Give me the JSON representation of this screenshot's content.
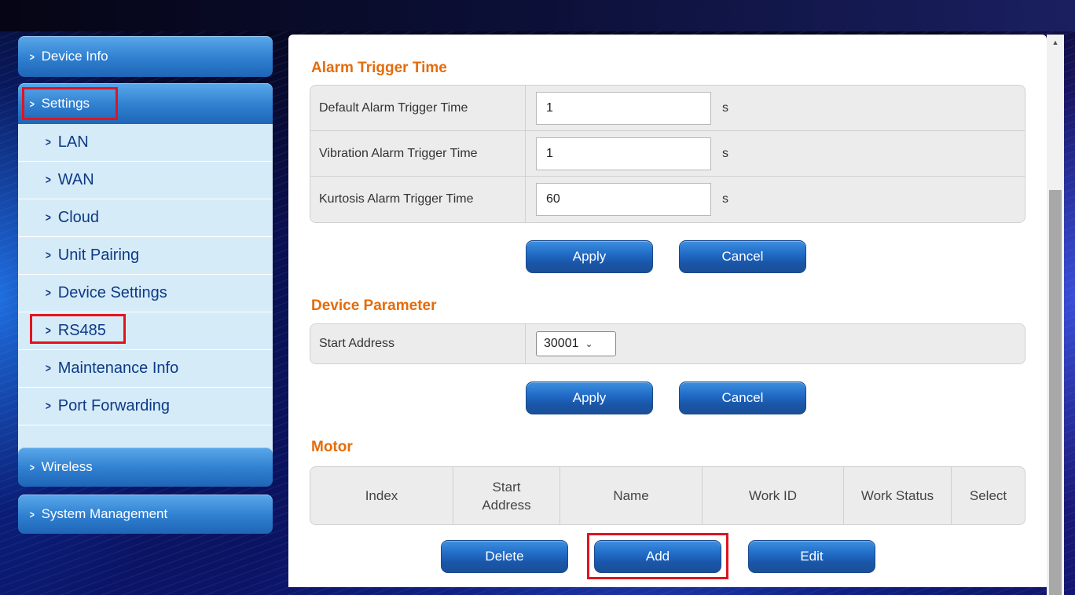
{
  "sidebar": {
    "device_info": "Device Info",
    "settings": "Settings",
    "settings_items": [
      "LAN",
      "WAN",
      "Cloud",
      "Unit Pairing",
      "Device Settings",
      "RS485",
      "Maintenance Info",
      "Port Forwarding"
    ],
    "wireless": "Wireless",
    "system_management": "System Management"
  },
  "alarm": {
    "title": "Alarm Trigger Time",
    "rows": [
      {
        "label": "Default Alarm Trigger Time",
        "value": "1",
        "unit": "s"
      },
      {
        "label": "Vibration Alarm Trigger Time",
        "value": "1",
        "unit": "s"
      },
      {
        "label": "Kurtosis Alarm Trigger Time",
        "value": "60",
        "unit": "s"
      }
    ],
    "apply": "Apply",
    "cancel": "Cancel"
  },
  "device_param": {
    "title": "Device Parameter",
    "start_address_label": "Start Address",
    "start_address_value": "30001",
    "apply": "Apply",
    "cancel": "Cancel"
  },
  "motor": {
    "title": "Motor",
    "columns": [
      "Index",
      "Start Address",
      "Name",
      "Work ID",
      "Work Status",
      "Select"
    ],
    "delete": "Delete",
    "add": "Add",
    "edit": "Edit"
  },
  "icons": {
    "chevron": "chevron-right-icon",
    "caret": "chevron-down-icon",
    "scroll_up": "triangle-up-icon"
  },
  "colors": {
    "section_title": "#e46c0a",
    "highlight": "#e0141e",
    "button": "#1f69c4",
    "submenu_bg": "#d6ebf8"
  }
}
